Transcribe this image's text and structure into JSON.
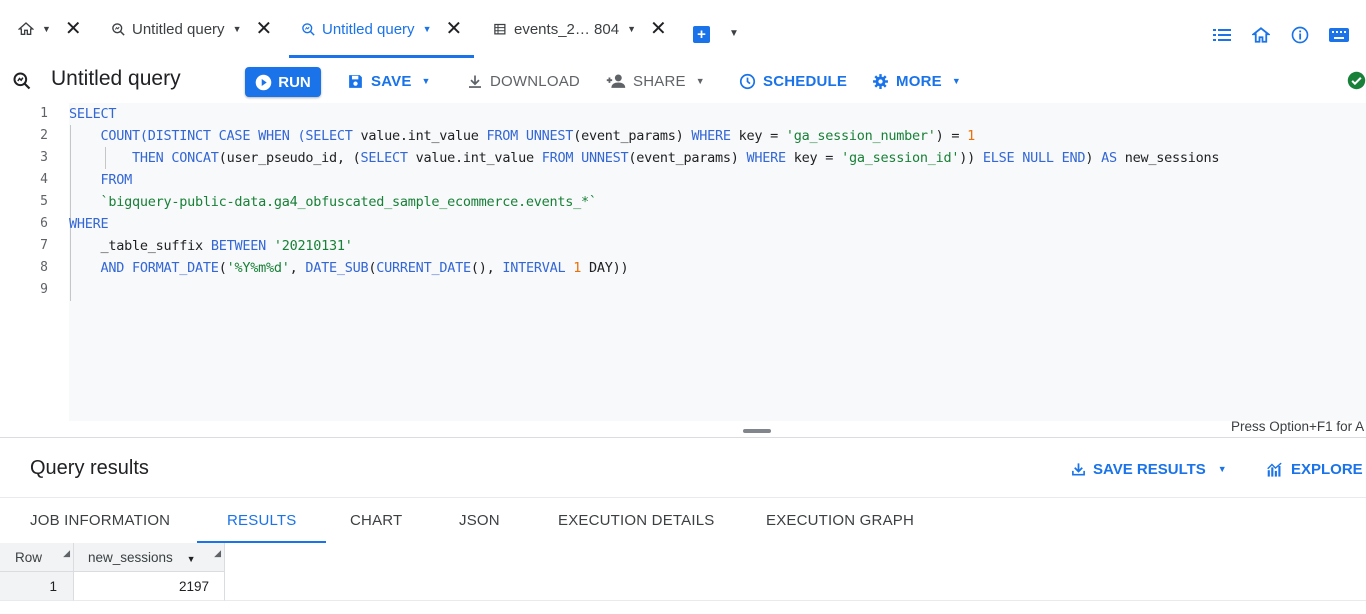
{
  "tabs": [
    {
      "label": "Untitled query",
      "active": false
    },
    {
      "label": "Untitled query",
      "active": true
    },
    {
      "label": "events_2… 804",
      "active": false
    }
  ],
  "toolbar": {
    "title": "Untitled query",
    "run_label": "RUN",
    "save_label": "SAVE",
    "download_label": "DOWNLOAD",
    "share_label": "SHARE",
    "schedule_label": "SCHEDULE",
    "more_label": "MORE"
  },
  "editor": {
    "line_numbers": [
      "1",
      "2",
      "3",
      "4",
      "5",
      "6",
      "7",
      "8",
      "9"
    ],
    "lines": [
      [
        {
          "t": "SELECT",
          "c": "kw"
        }
      ],
      [
        {
          "t": "    "
        },
        {
          "t": "COUNT(DISTINCT CASE WHEN (SELECT",
          "c": "kw"
        },
        {
          "t": " value.int_value "
        },
        {
          "t": "FROM UNNEST",
          "c": "kw"
        },
        {
          "t": "(event_params) "
        },
        {
          "t": "WHERE",
          "c": "kw"
        },
        {
          "t": " key = "
        },
        {
          "t": "'ga_session_number'",
          "c": "str"
        },
        {
          "t": ") = "
        },
        {
          "t": "1",
          "c": "num"
        }
      ],
      [
        {
          "t": "        "
        },
        {
          "t": "THEN CONCAT",
          "c": "kw"
        },
        {
          "t": "(user_pseudo_id, ("
        },
        {
          "t": "SELECT",
          "c": "kw"
        },
        {
          "t": " value.int_value "
        },
        {
          "t": "FROM UNNEST",
          "c": "kw"
        },
        {
          "t": "(event_params) "
        },
        {
          "t": "WHERE",
          "c": "kw"
        },
        {
          "t": " key = "
        },
        {
          "t": "'ga_session_id'",
          "c": "str"
        },
        {
          "t": ")) "
        },
        {
          "t": "ELSE NULL END",
          "c": "kw"
        },
        {
          "t": ") "
        },
        {
          "t": "AS",
          "c": "kw"
        },
        {
          "t": " new_sessions"
        }
      ],
      [
        {
          "t": "    "
        },
        {
          "t": "FROM",
          "c": "kw"
        }
      ],
      [
        {
          "t": "    "
        },
        {
          "t": "`bigquery-public-data.ga4_obfuscated_sample_ecommerce.events_*`",
          "c": "str"
        }
      ],
      [
        {
          "t": "WHERE",
          "c": "kw"
        }
      ],
      [
        {
          "t": "    _table_suffix "
        },
        {
          "t": "BETWEEN",
          "c": "kw"
        },
        {
          "t": " "
        },
        {
          "t": "'20210131'",
          "c": "str"
        }
      ],
      [
        {
          "t": "    "
        },
        {
          "t": "AND FORMAT_DATE",
          "c": "kw"
        },
        {
          "t": "("
        },
        {
          "t": "'%Y%m%d'",
          "c": "str"
        },
        {
          "t": ", "
        },
        {
          "t": "DATE_SUB",
          "c": "kw"
        },
        {
          "t": "("
        },
        {
          "t": "CURRENT_DATE",
          "c": "kw"
        },
        {
          "t": "(), "
        },
        {
          "t": "INTERVAL",
          "c": "kw"
        },
        {
          "t": " "
        },
        {
          "t": "1",
          "c": "num"
        },
        {
          "t": " DAY))"
        }
      ],
      []
    ],
    "hint": "Press Option+F1 for A"
  },
  "results": {
    "title": "Query results",
    "save_results_label": "SAVE RESULTS",
    "explore_label": "EXPLORE D",
    "tabs": [
      "JOB INFORMATION",
      "RESULTS",
      "CHART",
      "JSON",
      "EXECUTION DETAILS",
      "EXECUTION GRAPH"
    ],
    "active_tab": "RESULTS",
    "columns": [
      "Row",
      "new_sessions"
    ],
    "rows": [
      [
        "1",
        "2197"
      ]
    ]
  },
  "colors": {
    "accent": "#1a73e8",
    "success": "#188038"
  },
  "icons": [
    "home-icon",
    "query-icon",
    "table-icon",
    "add-tab-icon",
    "list-icon",
    "house-icon",
    "info-icon",
    "keyboard-icon",
    "play-icon",
    "save-icon",
    "download-icon",
    "share-icon",
    "schedule-icon",
    "gear-icon",
    "check-circle-icon"
  ]
}
